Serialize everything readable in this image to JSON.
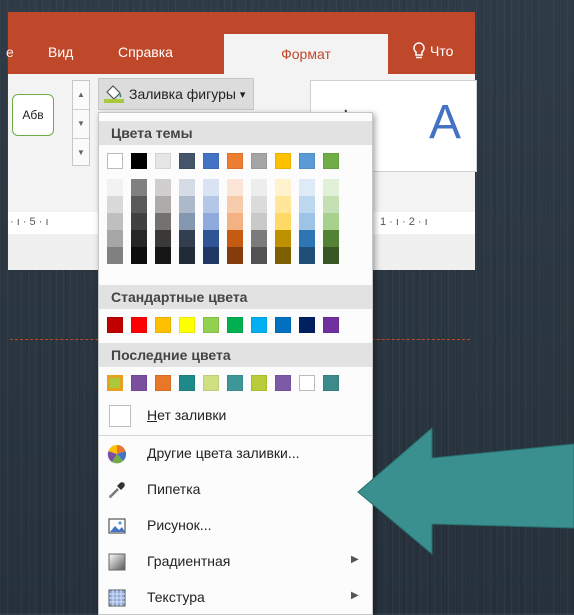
{
  "ribbon": {
    "tabs": [
      "Вид",
      "Справка"
    ],
    "active_tab": "Формат",
    "tell_me": "Что",
    "shape_style_sample": "Абв",
    "fill_button_label": "Заливка фигуры",
    "fill_dropdown_glyph": "▾",
    "wordart_sample": "A",
    "ruler_left": "· ı · 5 · ı",
    "ruler_right": "1 · ı · 2 · ı"
  },
  "dropdown": {
    "theme_colors_label": "Цвета темы",
    "theme_colors": [
      "#ffffff",
      "#000000",
      "#e7e6e6",
      "#44546a",
      "#4472c4",
      "#ed7d31",
      "#a5a5a5",
      "#ffc000",
      "#5b9bd5",
      "#70ad47"
    ],
    "theme_shades": [
      [
        "#f2f2f2",
        "#d9d9d9",
        "#bfbfbf",
        "#a6a6a6",
        "#808080"
      ],
      [
        "#808080",
        "#595959",
        "#404040",
        "#262626",
        "#0d0d0d"
      ],
      [
        "#d0cece",
        "#aeabab",
        "#757171",
        "#3b3838",
        "#171616"
      ],
      [
        "#d6dce5",
        "#adb9ca",
        "#8497b0",
        "#333f50",
        "#222a35"
      ],
      [
        "#dae3f3",
        "#b4c7e7",
        "#8faadc",
        "#2f5597",
        "#1f3864"
      ],
      [
        "#fbe5d6",
        "#f8cbad",
        "#f4b183",
        "#c55a11",
        "#843c0c"
      ],
      [
        "#ededed",
        "#dbdbdb",
        "#c9c9c9",
        "#7b7b7b",
        "#525252"
      ],
      [
        "#fff2cc",
        "#ffe699",
        "#ffd966",
        "#bf9000",
        "#7f6000"
      ],
      [
        "#deebf7",
        "#bdd7ee",
        "#9dc3e6",
        "#2e75b6",
        "#1f4e79"
      ],
      [
        "#e2f0d9",
        "#c5e0b4",
        "#a9d18e",
        "#548235",
        "#385723"
      ]
    ],
    "standard_colors_label": "Стандартные цвета",
    "standard_colors": [
      "#c00000",
      "#ff0000",
      "#ffc000",
      "#ffff00",
      "#92d050",
      "#00b050",
      "#00b0f0",
      "#0070c0",
      "#002060",
      "#7030a0"
    ],
    "recent_colors_label": "Последние цвета",
    "recent_colors": [
      "#a9c93a",
      "#7b4fa0",
      "#e8772a",
      "#1f8a8a",
      "#cfe083",
      "#3d9797",
      "#b7cc38",
      "#7c5aa6",
      "#ffffff",
      "#3c8a8a"
    ],
    "no_fill_label": "Нет заливки",
    "items": [
      {
        "label": "Другие цвета заливки...",
        "has_submenu": false
      },
      {
        "label": "Пипетка",
        "has_submenu": false
      },
      {
        "label": "Рисунок...",
        "has_submenu": false
      },
      {
        "label": "Градиентная",
        "has_submenu": true
      },
      {
        "label": "Текстура",
        "has_submenu": true
      }
    ],
    "submenu_glyph": "▶"
  },
  "annotation": {
    "arrow_color": "#3a8f8f"
  }
}
